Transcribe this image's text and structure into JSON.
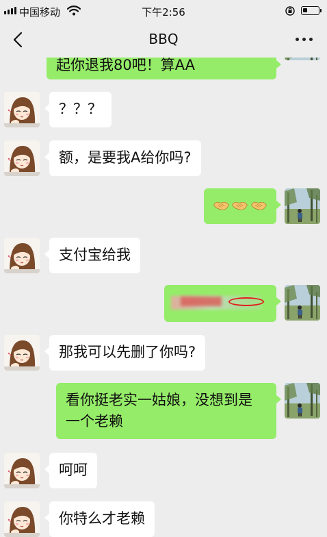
{
  "status_bar": {
    "carrier": "中国移动",
    "time": "下午2:56"
  },
  "nav": {
    "title": "BBQ"
  },
  "messages": [
    {
      "side": "out",
      "text": "起你退我80吧！算AA"
    },
    {
      "side": "in",
      "text": "？？？"
    },
    {
      "side": "in",
      "text": "额，是要我A给你吗?"
    },
    {
      "side": "out",
      "emoji": "handshake-icon",
      "count": 3
    },
    {
      "side": "in",
      "text": "支付宝给我"
    },
    {
      "side": "out",
      "text": "",
      "note": "redacted"
    },
    {
      "side": "in",
      "text": "那我可以先删了你吗?"
    },
    {
      "side": "out",
      "line1": "看你挺老实一姑娘，没想到是",
      "line2": "一个老赖"
    },
    {
      "side": "in",
      "text": "呵呵"
    },
    {
      "side": "in",
      "text": "你特么才老赖"
    }
  ],
  "colors": {
    "background": "#ededed",
    "outgoing_bubble": "#95ec69",
    "incoming_bubble": "#ffffff"
  }
}
